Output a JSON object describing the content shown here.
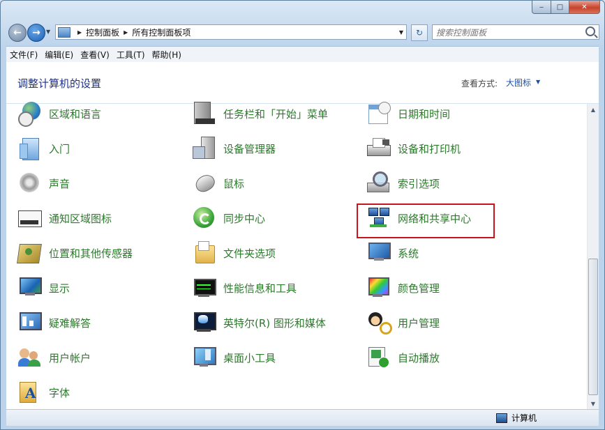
{
  "window": {
    "caption_min": "‒",
    "caption_max": "□",
    "caption_close": "✕"
  },
  "nav": {
    "back_glyph": "←",
    "fwd_glyph": "→",
    "breadcrumb": [
      "控制面板",
      "所有控制面板项"
    ],
    "breadcrumb_sep": "▶",
    "dropdown_glyph": "▼",
    "refresh_glyph": "↻",
    "search_placeholder": "搜索控制面板"
  },
  "menubar": {
    "items": [
      "文件(F)",
      "编辑(E)",
      "查看(V)",
      "工具(T)",
      "帮助(H)"
    ]
  },
  "content": {
    "title": "调整计算机的设置",
    "view_label": "查看方式:",
    "view_value": "大图标",
    "view_arrow": "▼"
  },
  "items": [
    {
      "label": "区域和语言",
      "icon": "globe-clock-icon"
    },
    {
      "label": "任务栏和「开始」菜单",
      "icon": "taskbar-icon"
    },
    {
      "label": "日期和时间",
      "icon": "calendar-clock-icon"
    },
    {
      "label": "入门",
      "icon": "getting-started-icon"
    },
    {
      "label": "设备管理器",
      "icon": "device-manager-icon"
    },
    {
      "label": "设备和打印机",
      "icon": "printer-icon"
    },
    {
      "label": "声音",
      "icon": "speaker-icon"
    },
    {
      "label": "鼠标",
      "icon": "mouse-icon"
    },
    {
      "label": "索引选项",
      "icon": "index-search-icon"
    },
    {
      "label": "通知区域图标",
      "icon": "notification-area-icon"
    },
    {
      "label": "同步中心",
      "icon": "sync-icon"
    },
    {
      "label": "网络和共享中心",
      "icon": "network-icon"
    },
    {
      "label": "位置和其他传感器",
      "icon": "location-sensor-icon"
    },
    {
      "label": "文件夹选项",
      "icon": "folder-options-icon"
    },
    {
      "label": "系统",
      "icon": "system-icon"
    },
    {
      "label": "显示",
      "icon": "display-icon"
    },
    {
      "label": "性能信息和工具",
      "icon": "performance-icon"
    },
    {
      "label": "颜色管理",
      "icon": "color-management-icon"
    },
    {
      "label": "疑难解答",
      "icon": "troubleshoot-icon"
    },
    {
      "label": "英特尔(R) 图形和媒体",
      "icon": "intel-graphics-icon"
    },
    {
      "label": "用户管理",
      "icon": "user-management-icon"
    },
    {
      "label": "用户帐户",
      "icon": "user-accounts-icon"
    },
    {
      "label": "桌面小工具",
      "icon": "gadgets-icon"
    },
    {
      "label": "自动播放",
      "icon": "autoplay-icon"
    },
    {
      "label": "字体",
      "icon": "fonts-icon"
    }
  ],
  "scrollbar": {
    "up": "▲",
    "down": "▼"
  },
  "status": {
    "computer": "计算机"
  },
  "colors": {
    "link_green": "#2b7a2b",
    "title_blue": "#1e3287",
    "highlight_red": "#c8141c"
  }
}
